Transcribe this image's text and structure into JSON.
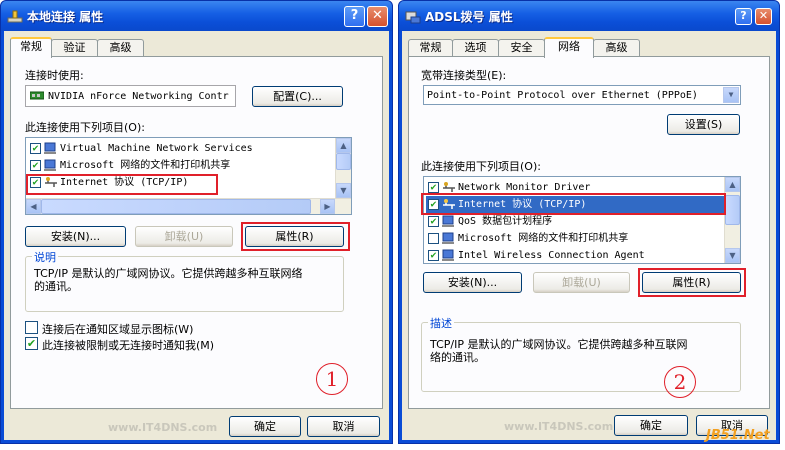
{
  "dialog1": {
    "title": "本地连接 属性",
    "tabs": [
      "常规",
      "验证",
      "高级"
    ],
    "connect_using_label": "连接时使用:",
    "adapter_name": "NVIDIA nForce Networking Contr",
    "configure_button": "配置(C)...",
    "items_label": "此连接使用下列项目(O):",
    "items": [
      {
        "label": "Virtual Machine Network Services",
        "checked": true,
        "icon": "network-client-icon"
      },
      {
        "label": "Microsoft 网络的文件和打印机共享",
        "checked": true,
        "icon": "network-client-icon"
      },
      {
        "label": "Internet 协议 (TCP/IP)",
        "checked": true,
        "icon": "protocol-icon"
      }
    ],
    "install_button": "安装(N)...",
    "uninstall_button": "卸载(U)",
    "properties_button": "属性(R)",
    "description_title": "说明",
    "description_text": [
      "TCP/IP 是默认的广域网协议。它提供跨越多种互联网络",
      "的通讯。"
    ],
    "show_icon_label": "连接后在通知区域显示图标(W)",
    "show_icon_checked": false,
    "notify_label": "此连接被限制或无连接时通知我(M)",
    "notify_checked": true,
    "ok_button": "确定",
    "cancel_button": "取消",
    "circle_number": "1"
  },
  "dialog2": {
    "title": "ADSL拨号 属性",
    "tabs": [
      "常规",
      "选项",
      "安全",
      "网络",
      "高级"
    ],
    "type_label": "宽带连接类型(E):",
    "type_value": "Point-to-Point Protocol over Ethernet (PPPoE)",
    "settings_button": "设置(S)",
    "items_label": "此连接使用下列项目(O):",
    "items": [
      {
        "label": "Network Monitor Driver",
        "checked": true,
        "icon": "protocol-icon"
      },
      {
        "label": "Internet 协议 (TCP/IP)",
        "checked": true,
        "icon": "protocol-icon"
      },
      {
        "label": "QoS 数据包计划程序",
        "checked": true,
        "icon": "network-client-icon"
      },
      {
        "label": "Microsoft 网络的文件和打印机共享",
        "checked": false,
        "icon": "network-client-icon"
      },
      {
        "label": "Intel Wireless Connection Agent",
        "checked": true,
        "icon": "network-client-icon"
      }
    ],
    "install_button": "安装(N)...",
    "uninstall_button": "卸载(U)",
    "properties_button": "属性(R)",
    "description_title": "描述",
    "description_text": [
      "TCP/IP 是默认的广域网协议。它提供跨越多种互联网",
      "络的通讯。"
    ],
    "ok_button": "确定",
    "cancel_button": "取消",
    "circle_number": "2"
  },
  "watermark": "www.IT4DNS.com",
  "site_logo": "JB51.Net",
  "colors": {
    "titlebar": "#0a4cd6",
    "annotation_red": "#e0202a",
    "selection": "#316ac5",
    "tab_highlight": "#ffc83c"
  }
}
